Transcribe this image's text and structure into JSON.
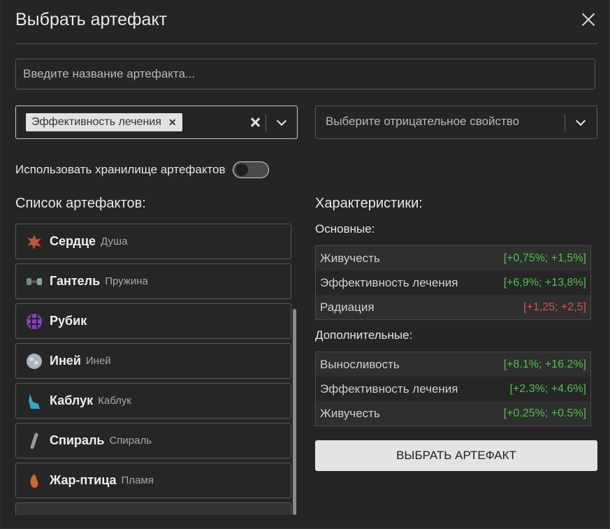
{
  "dialog": {
    "title": "Выбрать артефакт"
  },
  "search": {
    "placeholder": "Введите название артефакта..."
  },
  "positive_select": {
    "chip": "Эффективность лечения"
  },
  "negative_select": {
    "placeholder": "Выберите отрицательное свойство"
  },
  "storage_toggle": {
    "label": "Использовать хранилище артефактов",
    "on": false
  },
  "list": {
    "title": "Список артефактов:",
    "items": [
      {
        "name": "Сердце",
        "sub": "Душа",
        "icon": "heart-artifact-icon",
        "color": "#c0533a"
      },
      {
        "name": "Гантель",
        "sub": "Пружина",
        "icon": "dumbbell-artifact-icon",
        "color": "#6d8a8e"
      },
      {
        "name": "Рубик",
        "sub": "",
        "icon": "cube-artifact-icon",
        "color": "#8a3fb5"
      },
      {
        "name": "Иней",
        "sub": "Иней",
        "icon": "frost-artifact-icon",
        "color": "#a9b4bc"
      },
      {
        "name": "Каблук",
        "sub": "Каблук",
        "icon": "heel-artifact-icon",
        "color": "#3aa0c9"
      },
      {
        "name": "Спираль",
        "sub": "Спираль",
        "icon": "spiral-artifact-icon",
        "color": "#9a9a9a"
      },
      {
        "name": "Жар-птица",
        "sub": "Пламя",
        "icon": "firebird-artifact-icon",
        "color": "#c66a2e"
      }
    ]
  },
  "stats": {
    "title": "Характеристики:",
    "main_title": "Основные:",
    "main": [
      {
        "name": "Живучесть",
        "value": "[+0,75%; +1,5%]",
        "color": "#4cc34c"
      },
      {
        "name": "Эффективность лечения",
        "value": "[+6,9%; +13,8%]",
        "color": "#4cc34c"
      },
      {
        "name": "Радиация",
        "value": "[+1,25; +2,5]",
        "color": "#d85050"
      }
    ],
    "extra_title": "Дополнительные:",
    "extra": [
      {
        "name": "Выносливость",
        "value": "[+8.1%; +16.2%]",
        "color": "#4cc34c"
      },
      {
        "name": "Эффективность лечения",
        "value": "[+2.3%; +4.6%]",
        "color": "#4cc34c"
      },
      {
        "name": "Живучесть",
        "value": "[+0.25%; +0.5%]",
        "color": "#4cc34c"
      }
    ]
  },
  "action": {
    "label": "ВЫБРАТЬ АРТЕФАКТ"
  }
}
